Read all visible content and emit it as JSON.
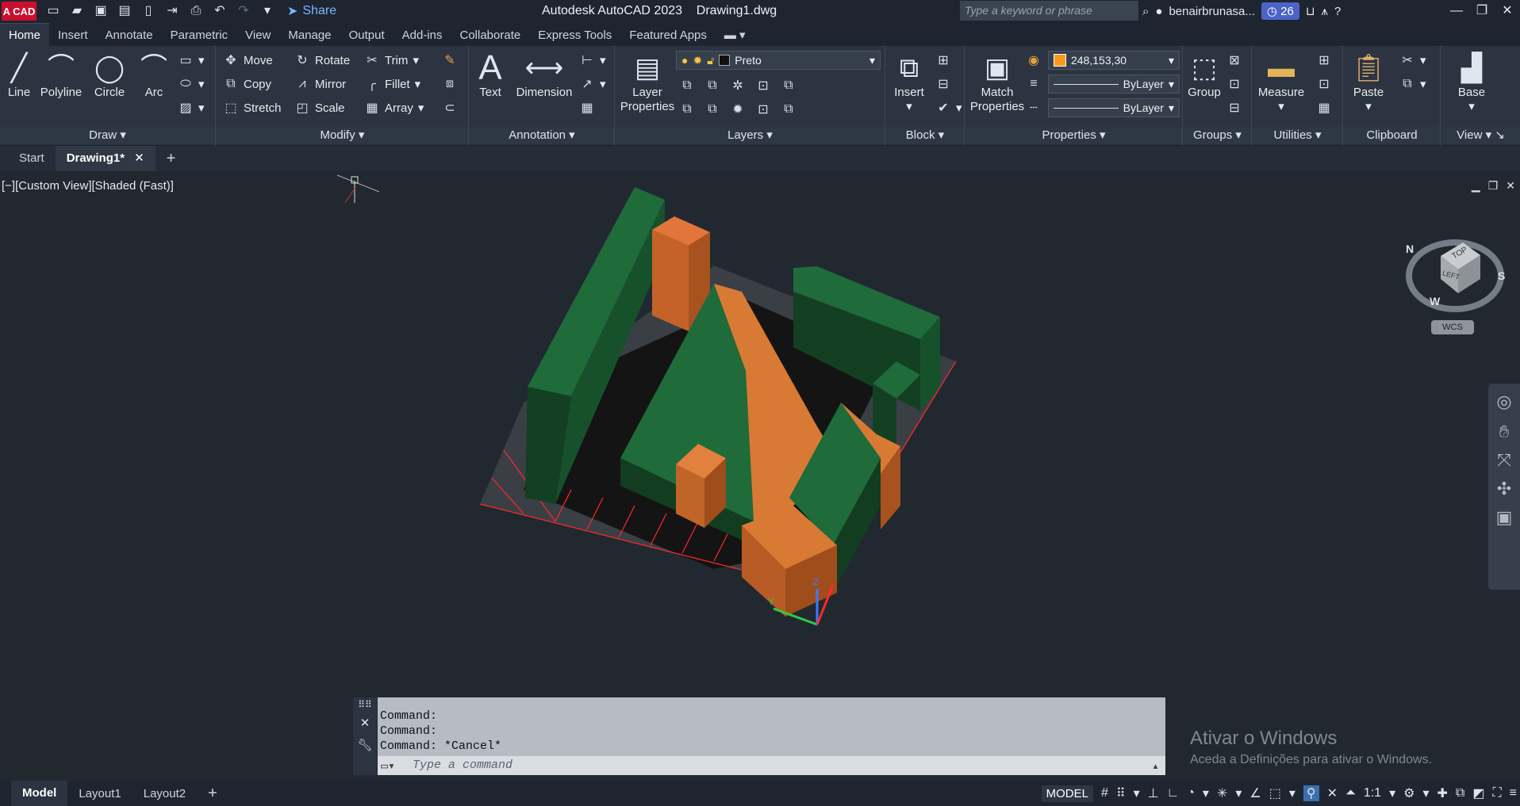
{
  "app": {
    "title": "Autodesk AutoCAD 2023",
    "file": "Drawing1.dwg",
    "logo": "A CAD"
  },
  "quick_access": {
    "share": "Share"
  },
  "search": {
    "placeholder": "Type a keyword or phrase"
  },
  "user": {
    "name": "benairbrunasa...",
    "clock_count": "26"
  },
  "ribbon_tabs": [
    "Home",
    "Insert",
    "Annotate",
    "Parametric",
    "View",
    "Manage",
    "Output",
    "Add-ins",
    "Collaborate",
    "Express Tools",
    "Featured Apps"
  ],
  "draw": {
    "title": "Draw",
    "line": "Line",
    "polyline": "Polyline",
    "circle": "Circle",
    "arc": "Arc"
  },
  "modify": {
    "title": "Modify",
    "move": "Move",
    "rotate": "Rotate",
    "trim": "Trim",
    "copy": "Copy",
    "mirror": "Mirror",
    "fillet": "Fillet",
    "stretch": "Stretch",
    "scale": "Scale",
    "array": "Array"
  },
  "annotation": {
    "title": "Annotation",
    "text": "Text",
    "dimension": "Dimension"
  },
  "layers": {
    "title": "Layers",
    "properties_line1": "Layer",
    "properties_line2": "Properties",
    "current": "Preto"
  },
  "block": {
    "title": "Block",
    "insert": "Insert"
  },
  "properties": {
    "title": "Properties",
    "match_line1": "Match",
    "match_line2": "Properties",
    "color": "248,153,30",
    "linetype": "ByLayer",
    "lineweight": "ByLayer"
  },
  "groups": {
    "title": "Groups",
    "group": "Group"
  },
  "utilities": {
    "title": "Utilities",
    "measure": "Measure"
  },
  "clipboard": {
    "title": "Clipboard",
    "paste": "Paste"
  },
  "view": {
    "title": "View",
    "base": "Base"
  },
  "file_tabs": {
    "start": "Start",
    "drawing": "Drawing1*"
  },
  "viewport": {
    "label": "[−][Custom View][Shaded (Fast)]"
  },
  "viewcube": {
    "top": "TOP",
    "left": "LEFT",
    "north": "N",
    "south": "S",
    "west": "W",
    "wcs": "WCS"
  },
  "command": {
    "history": [
      "Command:",
      "Command:",
      "Command: *Cancel*"
    ],
    "placeholder": "Type a command"
  },
  "watermark": {
    "line1": "Ativar o Windows",
    "line2": "Aceda a Definições para ativar o Windows."
  },
  "layout_tabs": {
    "model": "Model",
    "layout1": "Layout1",
    "layout2": "Layout2"
  },
  "statusbar": {
    "mode": "MODEL",
    "scale": "1:1"
  },
  "colors": {
    "accent": "#f8991e",
    "green": "#1d5f34",
    "orange": "#d9752c",
    "swatch": "#f8991e"
  }
}
